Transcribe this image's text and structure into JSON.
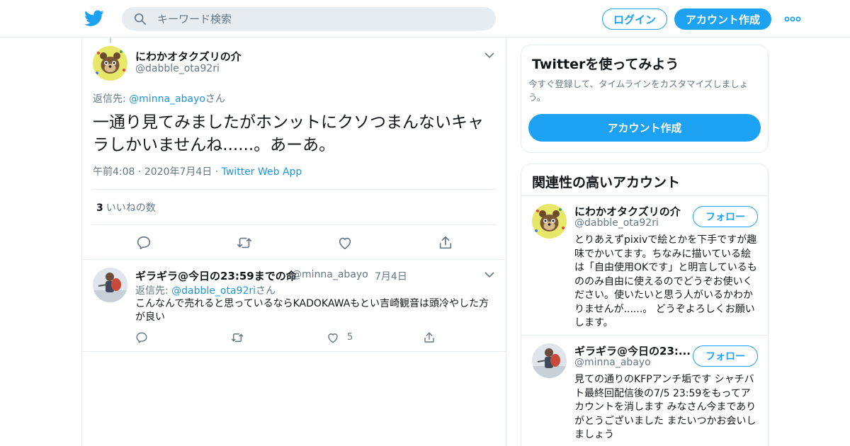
{
  "header": {
    "search_placeholder": "キーワード検索",
    "login_label": "ログイン",
    "signup_label": "アカウント作成"
  },
  "tweet": {
    "author_name": "にわかオタクズリの介",
    "author_handle": "@dabble_ota92ri",
    "reply_prefix": "返信先: ",
    "reply_to": "@minna_abayo",
    "reply_suffix": "さん",
    "text": "一通り見てみましたがホンットにクソつまんないキャラしかいませんね......。あーあ。",
    "time": "午前4:08",
    "date": "2020年7月4日",
    "source": "Twitter Web App",
    "like_count": "3",
    "like_label": "いいねの数"
  },
  "reply": {
    "author_name": "ギラギラ@今日の23:59までの命",
    "author_handle": "@minna_abayo",
    "date": "7月4日",
    "reply_prefix": "返信先: ",
    "reply_to": "@dabble_ota92ri",
    "reply_suffix": "さん",
    "text": "こんなんで売れると思っているならKADOKAWAもとい吉崎観音は頭冷やした方が良い",
    "like_count": "5"
  },
  "sidebar": {
    "signup_card": {
      "title": "Twitterを使ってみよう",
      "description": "今すぐ登録して、タイムラインをカスタマイズしましょう。",
      "button_label": "アカウント作成"
    },
    "related": {
      "title": "関連性の高いアカウント",
      "follow_label": "フォロー",
      "accounts": [
        {
          "name": "にわかオタクズリの介",
          "handle": "@dabble_ota92ri",
          "bio": "とりあえずpixivで絵とかを下手ですが趣味でかいてます。ちなみに描いている絵は「自由使用OKです」と明言しているもののみ自由に使えるのでどうぞお使いください。使いたいと思う人がいるかわかりませんが......。 どうぞよろしくお願いします。"
        },
        {
          "name": "ギラギラ@今日の23:...",
          "handle": "@minna_abayo",
          "bio": "見ての通りのKFPアンチ垢です シャチバト最終回配信後の7/5 23:59をもってアカウントを消します みなさん今までありがとうございました またいつかお会いしましょう"
        }
      ]
    }
  },
  "colors": {
    "accent": "#1da1f2",
    "link": "#1b95e0",
    "secondary_text": "#657786",
    "border": "#e6ecf0"
  },
  "icons": [
    "twitter-bird-icon",
    "search-icon",
    "more-dots-icon",
    "chevron-down-icon",
    "reply-icon",
    "retweet-icon",
    "like-icon",
    "share-icon"
  ]
}
